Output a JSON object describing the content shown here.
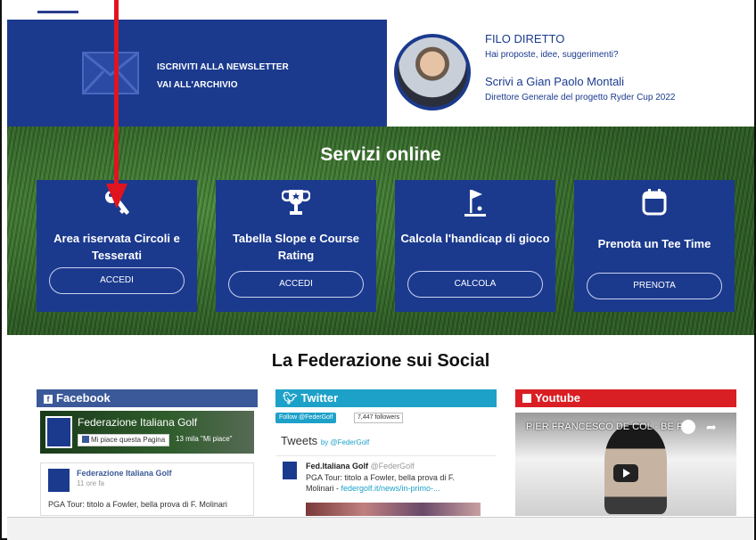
{
  "newsletter": {
    "subscribe_label": "ISCRIVITI ALLA NEWSLETTER",
    "archive_label": "VAI ALL'ARCHIVIO"
  },
  "filo_diretto": {
    "title": "FILO DIRETTO",
    "subtitle": "Hai proposte, idee, suggerimenti?",
    "write_label": "Scrivi a Gian Paolo Montali",
    "role": "Direttore Generale del progetto Ryder Cup 2022"
  },
  "services": {
    "title": "Servizi online",
    "cards": [
      {
        "icon": "key-icon",
        "title": "Area riservata Circoli e Tesserati",
        "button": "ACCEDI"
      },
      {
        "icon": "trophy-icon",
        "title": "Tabella Slope e Course Rating",
        "button": "ACCEDI"
      },
      {
        "icon": "golf-flag-icon",
        "title": "Calcola l'handicap di gioco",
        "button": "CALCOLA"
      },
      {
        "icon": "calendar-icon",
        "title": "Prenota un Tee Time",
        "button": "PRENOTA"
      }
    ]
  },
  "social": {
    "title": "La Federazione sui Social",
    "facebook": {
      "header": "Facebook",
      "page_name": "Federazione Italiana Golf",
      "like_button": "Mi piace questa Pagina",
      "likes": "13 mila \"Mi piace\"",
      "post_author": "Federazione Italiana Golf",
      "post_time": "11 ore fa",
      "post_text": "PGA Tour: titolo a Fowler, bella prova di F. Molinari"
    },
    "twitter": {
      "header": "Twitter",
      "follow_button": "Follow @FederGolf",
      "followers": "7,447 followers",
      "tweets_label": "Tweets",
      "tweets_by": "by @FederGolf",
      "tweet_author": "Fed.Italiana Golf",
      "tweet_handle": "@FederGolf",
      "tweet_text": "PGA Tour: titolo a Fowler, bella prova di F. Molinari - ",
      "tweet_link": "federgolf.it/news/in-primo-..."
    },
    "youtube": {
      "header": "Youtube",
      "video_title": "PIER FRANCESCO DE COL - BE F..."
    }
  },
  "colors": {
    "brand_blue": "#1b3a8e",
    "facebook": "#3b5998",
    "twitter": "#1da1c9",
    "youtube": "#d91e24",
    "annotation_arrow": "#e0141e"
  }
}
